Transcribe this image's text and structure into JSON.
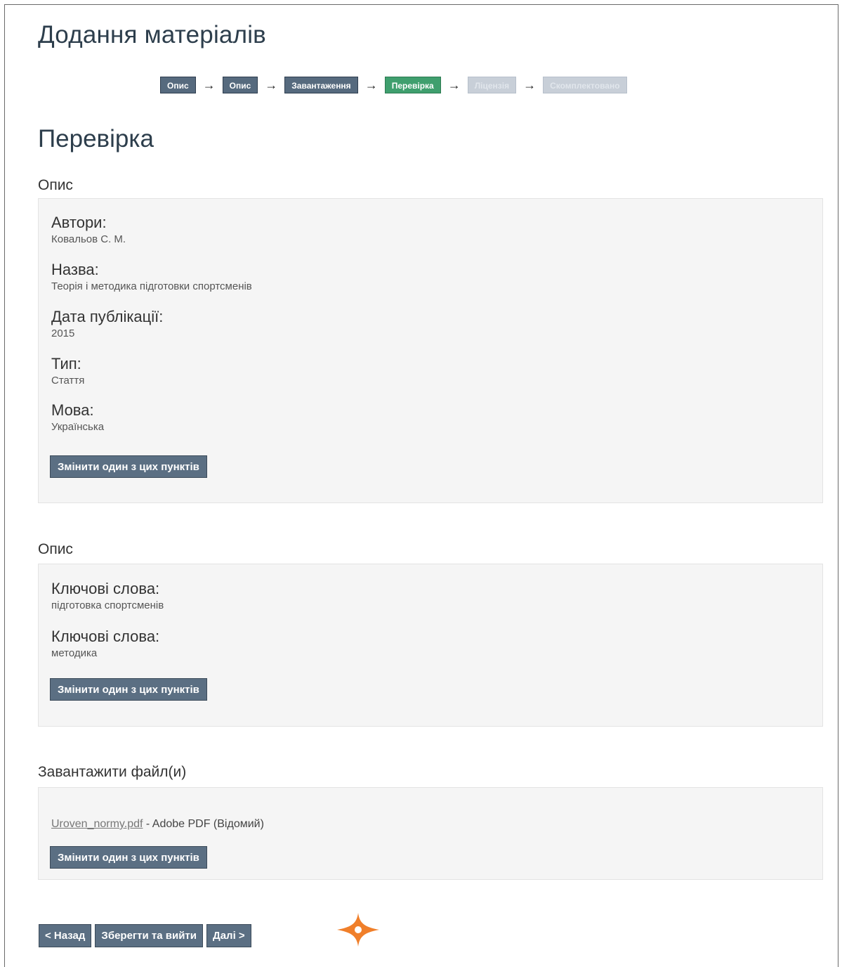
{
  "page": {
    "title": "Додання матеріалів"
  },
  "progress": {
    "steps": [
      {
        "label": "Опис",
        "state": "done"
      },
      {
        "label": "Опис",
        "state": "done"
      },
      {
        "label": "Завантаження",
        "state": "done"
      },
      {
        "label": "Перевірка",
        "state": "current"
      },
      {
        "label": "Ліцензія",
        "state": "upcoming"
      },
      {
        "label": "Скомплектовано",
        "state": "upcoming"
      }
    ],
    "arrow": "→"
  },
  "section": {
    "title": "Перевірка"
  },
  "describe1": {
    "heading": "Опис",
    "fields": [
      {
        "label": "Автори:",
        "value": "Ковальов С. М."
      },
      {
        "label": "Назва:",
        "value": "Теорія і методика підготовки спортсменів"
      },
      {
        "label": "Дата публікації:",
        "value": "2015"
      },
      {
        "label": "Тип:",
        "value": "Стаття"
      },
      {
        "label": "Мова:",
        "value": "Українська"
      }
    ],
    "edit_button": "Змінити один з цих пунктів"
  },
  "describe2": {
    "heading": "Опис",
    "fields": [
      {
        "label": "Ключові слова:",
        "value": "підготовка спортсменів"
      },
      {
        "label": "Ключові слова:",
        "value": "методика"
      }
    ],
    "edit_button": "Змінити один з цих пунктів"
  },
  "upload": {
    "heading": "Завантажити файл(и)",
    "file_name": "Uroven_normy.pdf",
    "file_info": " - Adobe PDF (Відомий)",
    "edit_button": "Змінити один з цих пунктів"
  },
  "navigation": {
    "back": "< Назад",
    "save_exit": "Зберегти та вийти",
    "next": "Далі >"
  },
  "colors": {
    "step_done": "#566a7e",
    "step_current": "#3f9f6e",
    "step_upcoming": "#c8cfd8",
    "button": "#5b6f83",
    "cursor_highlight": "#f07f2a"
  }
}
